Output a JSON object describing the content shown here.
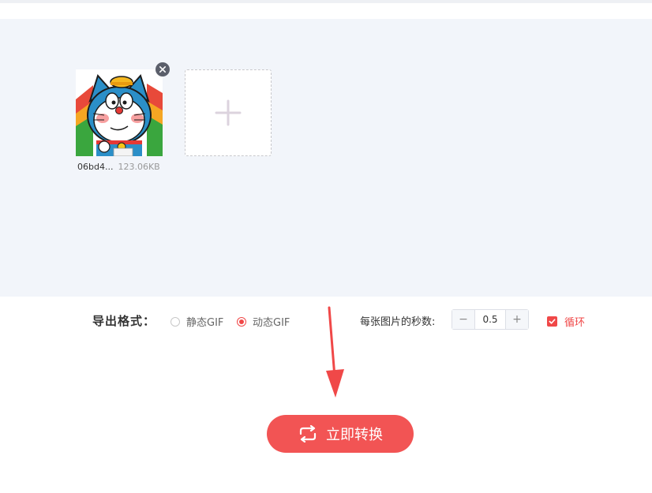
{
  "upload": {
    "files": [
      {
        "name": "06bd4...",
        "size": "123.06KB"
      }
    ],
    "add_icon": "plus-icon",
    "remove_icon": "close-icon"
  },
  "settings": {
    "format_label": "导出格式：",
    "options": [
      {
        "label": "静态GIF",
        "selected": false
      },
      {
        "label": "动态GIF",
        "selected": true
      }
    ],
    "seconds_label": "每张图片的秒数:",
    "seconds_value": "0.5",
    "minus_label": "−",
    "plus_label": "+",
    "loop_label": "循环",
    "loop_checked": true
  },
  "action": {
    "convert_label": "立即转换",
    "convert_icon": "repeat-icon"
  },
  "colors": {
    "accent": "#f25454",
    "upload_bg": "#f2f5fa"
  }
}
